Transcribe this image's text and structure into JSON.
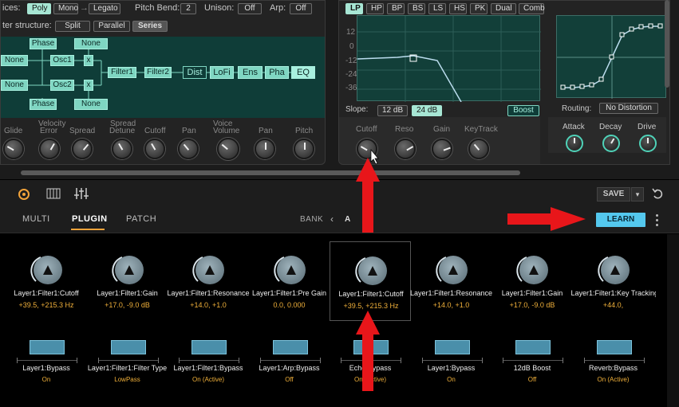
{
  "synth": {
    "voices_label": "ices:",
    "voice_modes": [
      "Poly",
      "Mono",
      "Legato"
    ],
    "pitch_bend_label": "Pitch Bend:",
    "pitch_bend_value": "2",
    "unison_label": "Unison:",
    "unison_value": "Off",
    "arp_label": "Arp:",
    "arp_value": "Off",
    "filter_structure_label": "ter structure:",
    "filter_structures": [
      "Split",
      "Parallel",
      "Series"
    ],
    "routing": {
      "phase1": "Phase",
      "none1": "None",
      "none_left1": "None",
      "osc1": "Osc1",
      "x1": "x",
      "none_left2": "None",
      "osc2": "Osc2",
      "x2": "x",
      "phase2": "Phase",
      "none2": "None",
      "filter1": "Filter1",
      "filter2": "Filter2",
      "dist": "Dist",
      "lofi": "LoFi",
      "ens": "Ens",
      "pha": "Pha",
      "eq": "EQ"
    },
    "group_labels": {
      "velocity": "Velocity",
      "spread": "Spread",
      "voice": "Voice"
    },
    "knobs": [
      "Glide",
      "Error",
      "Spread",
      "Detune",
      "Cutoff",
      "Pan",
      "Volume",
      "Pan",
      "Pitch"
    ],
    "filter_types": [
      "LP",
      "HP",
      "BP",
      "BS",
      "LS",
      "HS",
      "PK",
      "Dual",
      "Comb"
    ],
    "db_ticks": [
      "12",
      "0",
      "-12",
      "-24",
      "-36"
    ],
    "slope_label": "Slope:",
    "slopes": [
      "12 dB",
      "24 dB"
    ],
    "boost": "Boost",
    "routing_label": "Routing:",
    "routing_value": "No Distortion",
    "filter_knobs": [
      "Cutoff",
      "Reso",
      "Gain",
      "KeyTrack"
    ],
    "dist_knobs": [
      "Attack",
      "Decay",
      "Drive"
    ]
  },
  "toolbar": {
    "save": "SAVE"
  },
  "tabs": [
    "MULTI",
    "PLUGIN",
    "PATCH"
  ],
  "bank": {
    "label": "BANK",
    "prev": "‹",
    "value": "A"
  },
  "learn": "LEARN",
  "knob_params": [
    {
      "name": "Layer1:Filter1:Cutoff",
      "value": "+39.5, +215.3 Hz"
    },
    {
      "name": "Layer1:Filter1:Gain",
      "value": "+17.0, -9.0 dB"
    },
    {
      "name": "Layer1:Filter1:Resonance",
      "value": "+14.0, +1.0"
    },
    {
      "name": "Layer1:Filter1:Pre Gain",
      "value": "0.0,  0.000"
    },
    {
      "name": "Layer1:Filter1:Cutoff",
      "value": "+39.5, +215.3 Hz"
    },
    {
      "name": "Layer1:Filter1:Resonance",
      "value": "+14.0, +1.0"
    },
    {
      "name": "Layer1:Filter1:Gain",
      "value": "+17.0, -9.0 dB"
    },
    {
      "name": "Layer1:Filter1:Key Tracking",
      "value": "+44.0,"
    }
  ],
  "button_params": [
    {
      "name": "Layer1:Bypass",
      "value": "On"
    },
    {
      "name": "Layer1:Filter1:Filter Type",
      "value": "LowPass"
    },
    {
      "name": "Layer1:Filter1:Bypass",
      "value": "On (Active)"
    },
    {
      "name": "Layer1:Arp:Bypass",
      "value": "Off"
    },
    {
      "name": "Echo:Bypass",
      "value": "On (Active)"
    },
    {
      "name": "Layer1:Bypass",
      "value": "On"
    },
    {
      "name": "12dB Boost",
      "value": "Off"
    },
    {
      "name": "Reverb:Bypass",
      "value": "On (Active)"
    }
  ],
  "colors": {
    "accent_teal": "#7fd6c2",
    "learn_blue": "#54c8ee",
    "value_orange": "#f0b03a",
    "arrow_red": "#e8161a"
  }
}
